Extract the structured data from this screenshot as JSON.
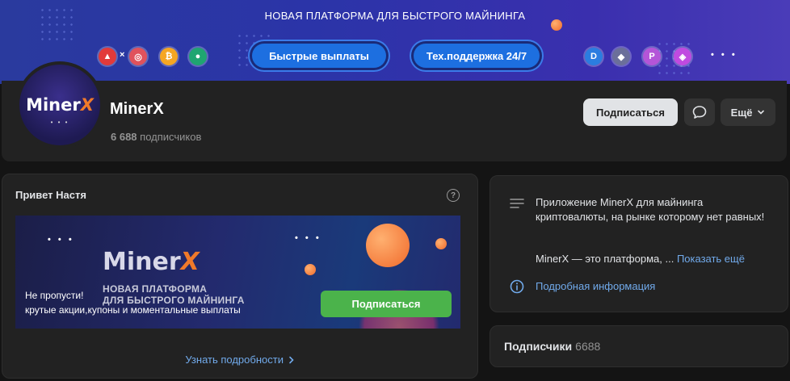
{
  "cover": {
    "title": "НОВАЯ ПЛАТФОРМА ДЛЯ БЫСТРОГО МАЙНИНГА",
    "pill_left": "Быстрые выплаты",
    "pill_right": "Тех.поддержка 24/7",
    "dots": "• • •",
    "coins_left": [
      "tron-icon",
      "coin-icon",
      "bitcoin-icon",
      "coin-icon"
    ],
    "coins_right": [
      "dash-icon",
      "ethereum-icon",
      "polkadot-icon",
      "binance-icon"
    ]
  },
  "profile": {
    "name": "MinerX",
    "subscribers_count": "6 688",
    "subscribers_label": "подписчиков",
    "avatar_logo_main": "Miner",
    "avatar_logo_x": "X",
    "avatar_dots": "• • •",
    "subscribe_label": "Подписаться",
    "more_label": "Ещё"
  },
  "widget": {
    "title": "Привет Настя",
    "help": "?",
    "promo": {
      "logo_main": "Miner",
      "logo_x": "X",
      "tag_line1": "НОВАЯ ПЛАТФОРМА",
      "tag_line2": "ДЛЯ БЫСТРОГО МАЙНИНГА",
      "text1": "Не пропусти!",
      "text2": "крутые акции,купоны и моментальные выплаты",
      "button": "Подписаться",
      "dots": "• • •"
    },
    "more_link": "Узнать подробности"
  },
  "info": {
    "description": "Приложение MinerX для майнинга криптовалюты, на рынке которому нет равных!",
    "description_short": "MinerX — это платформа, ...",
    "show_more": "Показать ещё",
    "details": "Подробная информация"
  },
  "subscribers_card": {
    "label": "Подписчики",
    "count": "6688"
  },
  "colors": {
    "background": "#141414",
    "card": "#222222",
    "accent_blue": "#71aaeb",
    "green_button": "#4bb34b",
    "orange": "#f07a2a"
  }
}
